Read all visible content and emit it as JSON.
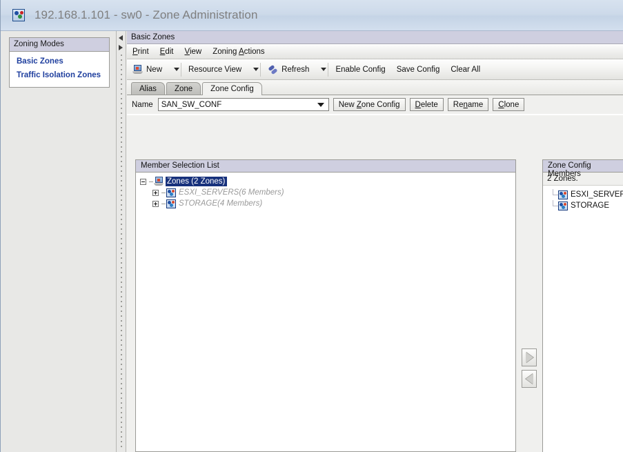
{
  "titlebar": {
    "icon": "app-icon",
    "text": "192.168.1.101 - sw0 - Zone Administration"
  },
  "sidebar": {
    "header": "Zoning Modes",
    "items": [
      {
        "label": "Basic Zones"
      },
      {
        "label": "Traffic Isolation Zones"
      }
    ]
  },
  "splitter": {
    "collapse_icon": "triangle-left-icon",
    "expand_icon": "triangle-right-icon"
  },
  "main": {
    "panel_title": "Basic Zones",
    "menu": [
      {
        "label": "Print",
        "mnemonic": "P"
      },
      {
        "label": "Edit",
        "mnemonic": "E"
      },
      {
        "label": "View",
        "mnemonic": "V"
      },
      {
        "label": "Zoning Actions",
        "mnemonic": "A"
      }
    ],
    "toolbar": {
      "new_label": "New",
      "new_icon": "new-switch-icon",
      "resource_view_label": "Resource View",
      "refresh_label": "Refresh",
      "refresh_icon": "refresh-arrows-icon",
      "enable_config_label": "Enable Config",
      "save_config_label": "Save Config",
      "clear_all_label": "Clear All",
      "dropdown_icon": "caret-down-icon"
    },
    "tabs": [
      {
        "label": "Alias",
        "active": false
      },
      {
        "label": "Zone",
        "active": false
      },
      {
        "label": "Zone Config",
        "active": true
      }
    ],
    "name_row": {
      "label": "Name",
      "selected_value": "SAN_SW_CONF",
      "dropdown_icon": "caret-down-icon",
      "buttons": [
        {
          "label": "New Zone Config",
          "pre": "New ",
          "mn": "Z",
          "post": "one Config"
        },
        {
          "label": "Delete",
          "pre": "",
          "mn": "D",
          "post": "elete"
        },
        {
          "label": "Rename",
          "pre": "Re",
          "mn": "n",
          "post": "ame"
        },
        {
          "label": "Clone",
          "pre": "",
          "mn": "C",
          "post": "lone"
        }
      ]
    },
    "member_selection": {
      "title": "Member Selection List",
      "root": {
        "label": "Zones (2 Zones)",
        "selected": true,
        "expanded": true,
        "icon": "switch-icon"
      },
      "children": [
        {
          "label": "ESXI_SERVERS(6 Members)",
          "expanded": false,
          "icon": "zone-icon"
        },
        {
          "label": "STORAGE(4 Members)",
          "expanded": false,
          "icon": "zone-icon"
        }
      ]
    },
    "transfer": {
      "add_icon": "triangle-right-icon",
      "remove_icon": "triangle-left-icon"
    },
    "zone_config_members": {
      "title": "Zone Config Members",
      "count_text": "2 Zones.",
      "items": [
        {
          "label": "ESXI_SERVERS",
          "icon": "zone-icon"
        },
        {
          "label": "STORAGE",
          "icon": "zone-icon"
        }
      ]
    }
  },
  "colors": {
    "title_bar": "#cddaea",
    "panel_header": "#cfcfe0",
    "selection": "#17317c",
    "link": "#1f3f9e",
    "dim_text": "#9a9a9a"
  }
}
